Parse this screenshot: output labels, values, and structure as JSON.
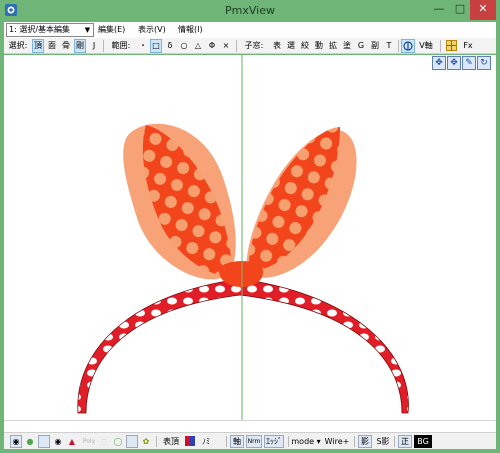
{
  "window": {
    "title": "PmxView"
  },
  "menubar": {
    "mode_select": "1: 選択/基本編集",
    "menus": [
      "編集(E)",
      "表示(V)",
      "情報(I)"
    ]
  },
  "toolbar": {
    "select_label": "選択:",
    "select_items": [
      "頂",
      "面",
      "骨",
      "剛",
      "J"
    ],
    "range_label": "範囲:",
    "range_items": [
      "・",
      "□",
      "δ",
      "○",
      "△",
      "Φ",
      "×"
    ],
    "fix_label": "子窓:",
    "fix_items": [
      "表",
      "選",
      "絞",
      "動",
      "拡",
      "塗",
      "G",
      "副",
      "T"
    ],
    "axis_label": "V軸",
    "fx_label": "Fx"
  },
  "viewport": {
    "nav_icons": [
      "move-icon",
      "pan-icon",
      "pen-icon",
      "rotate-icon"
    ]
  },
  "bottombar": {
    "vertex_label": "表頂",
    "no_label": "ﾉﾐ",
    "axis_label": "軸",
    "normal_label": "Nrm",
    "edge_label": "ｴｯｼﾞ",
    "mode_label": "mode ▾",
    "wire_label": "Wire+",
    "shadow_label": "影",
    "sshadow_label": "S影",
    "ortho_label": "正",
    "bg_label": "BG"
  },
  "colors": {
    "frame": "#6fb578",
    "ribbon_red": "#f2451c",
    "ribbon_outer": "#f79a6d",
    "band_red": "#e11e28",
    "guide_line": "#7fc27f"
  }
}
